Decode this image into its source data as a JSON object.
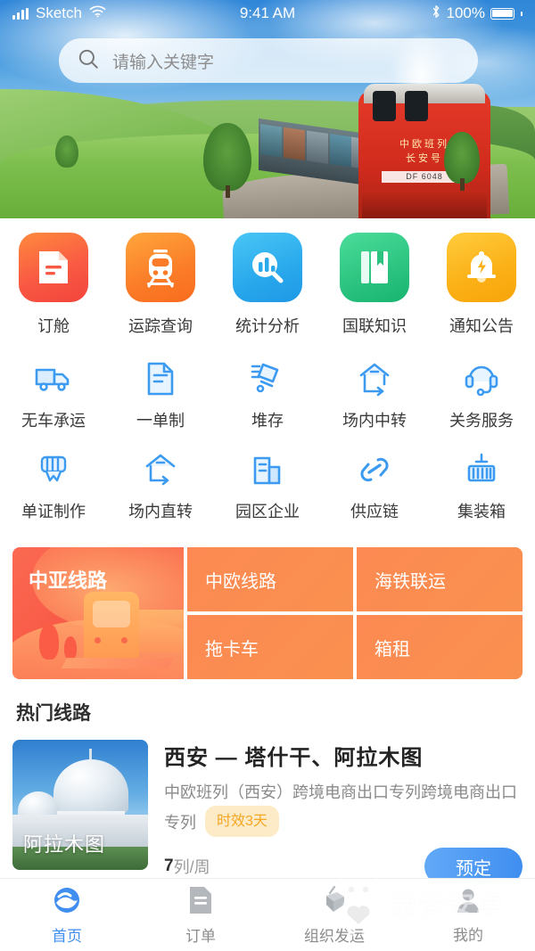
{
  "status_bar": {
    "carrier": "Sketch",
    "time": "9:41 AM",
    "battery_percent": "100%",
    "signal_icon": "signal-bars-icon",
    "wifi_icon": "wifi-icon",
    "bluetooth_icon": "bluetooth-icon",
    "battery_icon": "battery-full-icon"
  },
  "search": {
    "placeholder": "请输入关键字",
    "icon": "search-icon"
  },
  "banner": {
    "train_name": "中欧班列",
    "train_sub": "长安号",
    "train_plate": "DF 6048"
  },
  "primary_grid": [
    {
      "label": "订舱",
      "icon": "document-icon",
      "color": "#f95a43"
    },
    {
      "label": "运踪查询",
      "icon": "train-icon",
      "color": "#fb7c28"
    },
    {
      "label": "统计分析",
      "icon": "chart-search-icon",
      "color": "#29a8ec"
    },
    {
      "label": "国联知识",
      "icon": "book-icon",
      "color": "#2bc37f"
    },
    {
      "label": "通知公告",
      "icon": "bell-icon",
      "color": "#fbb016"
    }
  ],
  "secondary_grid": [
    {
      "label": "无车承运",
      "icon": "truck-icon"
    },
    {
      "label": "一单制",
      "icon": "single-document-icon"
    },
    {
      "label": "堆存",
      "icon": "stacking-cart-icon"
    },
    {
      "label": "场内中转",
      "icon": "warehouse-transfer-icon"
    },
    {
      "label": "关务服务",
      "icon": "headset-icon"
    },
    {
      "label": "单证制作",
      "icon": "certificate-scroll-icon"
    },
    {
      "label": "场内直转",
      "icon": "warehouse-direct-icon"
    },
    {
      "label": "园区企业",
      "icon": "buildings-icon"
    },
    {
      "label": "供应链",
      "icon": "chain-link-icon"
    },
    {
      "label": "集装箱",
      "icon": "container-crane-icon"
    }
  ],
  "route_tiles": {
    "featured": "中亚线路",
    "items": [
      {
        "label": "中欧线路"
      },
      {
        "label": "海铁联运"
      },
      {
        "label": "拖卡车"
      },
      {
        "label": "箱租"
      }
    ]
  },
  "hot_routes": {
    "section_title": "热门线路",
    "cards": [
      {
        "image_label": "阿拉木图",
        "title": "西安 — 塔什干、阿拉木图",
        "description": "中欧班列（西安）跨境电商出口专列跨境电商出口专列",
        "badge": "时效3天",
        "frequency_value": "7",
        "frequency_unit": "列/周",
        "book_label": "预定"
      }
    ]
  },
  "tabbar": [
    {
      "label": "首页",
      "icon": "home-icon",
      "active": true
    },
    {
      "label": "订单",
      "icon": "order-document-icon",
      "active": false
    },
    {
      "label": "组织发运",
      "icon": "crane-container-icon",
      "active": false
    },
    {
      "label": "我的",
      "icon": "user-profile-icon",
      "active": false
    }
  ],
  "watermark": {
    "title": "我爱安卓",
    "subtitle": "52android.com",
    "icon": "android-robot-icon"
  },
  "theme": {
    "accent_blue": "#3f8ef0",
    "accent_orange": "#fb7c28",
    "badge_bg": "#fdebc8",
    "badge_text": "#f5a623"
  }
}
